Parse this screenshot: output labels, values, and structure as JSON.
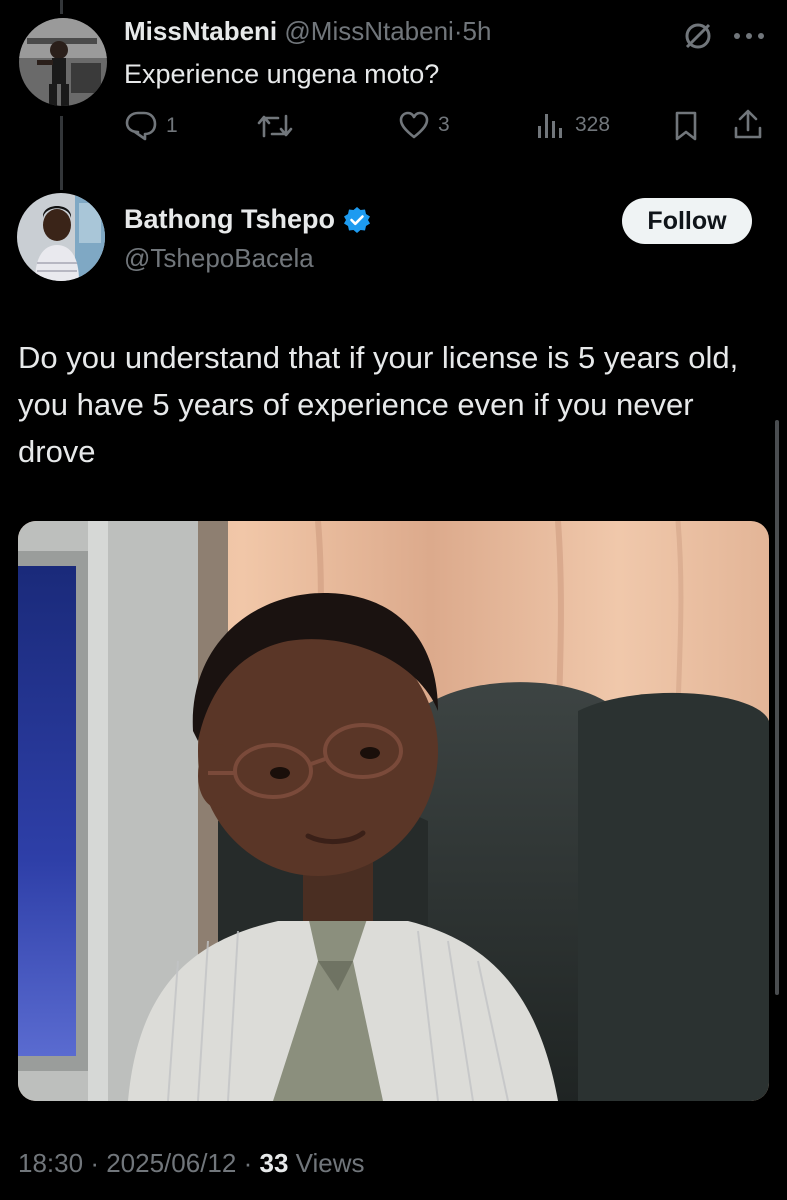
{
  "parent_tweet": {
    "display_name": "MissNtabeni",
    "handle": "@MissNtabeni",
    "separator": "·",
    "time_ago": "5h",
    "text": "Experience ungena moto?",
    "more_icon": "more-dots-icon",
    "grok_icon": "slashed-circle-icon",
    "actions": {
      "replies": "1",
      "retweets": "",
      "likes": "3",
      "views": "328"
    }
  },
  "main_tweet": {
    "display_name": "Bathong Tshepo",
    "handle": "@TshepoBacela",
    "verified": true,
    "follow_label": "Follow",
    "text": "Do you understand that if your license is 5 years old, you have 5 years of experience even if you never drove",
    "media_description": "meme-photo",
    "footer": {
      "time": "18:30",
      "date": "2025/06/12",
      "separator": "·",
      "views_count": "33",
      "views_label": "Views"
    }
  },
  "colors": {
    "background": "#000000",
    "primary_text": "#e7e9ea",
    "secondary_text": "#71767b",
    "verified_blue": "#1d9bf0",
    "follow_bg": "#eff3f4"
  }
}
